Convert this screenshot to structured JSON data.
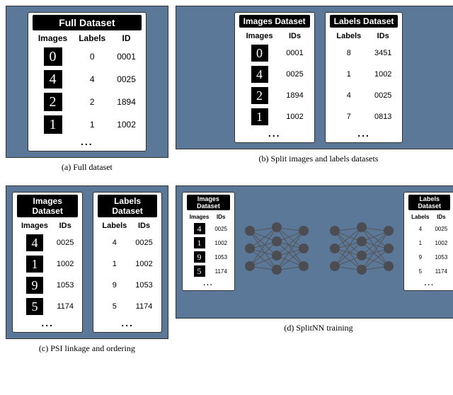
{
  "panels": {
    "a": {
      "caption": "(a) Full dataset",
      "tables": [
        {
          "title": "Full Dataset",
          "columns": [
            "Images",
            "Labels",
            "ID"
          ],
          "rows": [
            {
              "digit": "0",
              "label": "0",
              "id": "0001"
            },
            {
              "digit": "4",
              "label": "4",
              "id": "0025"
            },
            {
              "digit": "2",
              "label": "2",
              "id": "1894"
            },
            {
              "digit": "1",
              "label": "1",
              "id": "1002"
            }
          ],
          "ellipsis": "..."
        }
      ]
    },
    "b": {
      "caption": "(b) Split images and labels datasets",
      "tables": [
        {
          "title": "Images Dataset",
          "columns": [
            "Images",
            "IDs"
          ],
          "rows": [
            {
              "digit": "0",
              "id": "0001"
            },
            {
              "digit": "4",
              "id": "0025"
            },
            {
              "digit": "2",
              "id": "1894"
            },
            {
              "digit": "1",
              "id": "1002"
            }
          ],
          "ellipsis": "..."
        },
        {
          "title": "Labels Dataset",
          "columns": [
            "Labels",
            "IDs"
          ],
          "rows": [
            {
              "label": "8",
              "id": "3451"
            },
            {
              "label": "1",
              "id": "1002"
            },
            {
              "label": "4",
              "id": "0025"
            },
            {
              "label": "7",
              "id": "0813"
            }
          ],
          "ellipsis": "..."
        }
      ]
    },
    "c": {
      "caption": "(c) PSI linkage and ordering",
      "tables": [
        {
          "title": "Images Dataset",
          "columns": [
            "Images",
            "IDs"
          ],
          "rows": [
            {
              "digit": "4",
              "id": "0025"
            },
            {
              "digit": "1",
              "id": "1002"
            },
            {
              "digit": "9",
              "id": "1053"
            },
            {
              "digit": "5",
              "id": "1174"
            }
          ],
          "ellipsis": "..."
        },
        {
          "title": "Labels Dataset",
          "columns": [
            "Labels",
            "IDs"
          ],
          "rows": [
            {
              "label": "4",
              "id": "0025"
            },
            {
              "label": "1",
              "id": "1002"
            },
            {
              "label": "9",
              "id": "1053"
            },
            {
              "label": "5",
              "id": "1174"
            }
          ],
          "ellipsis": "..."
        }
      ]
    },
    "d": {
      "caption": "(d) SplitNN training",
      "tables": [
        {
          "title": "Images Dataset",
          "columns": [
            "Images",
            "IDs"
          ],
          "rows": [
            {
              "digit": "4",
              "id": "0025"
            },
            {
              "digit": "1",
              "id": "1002"
            },
            {
              "digit": "9",
              "id": "1053"
            },
            {
              "digit": "5",
              "id": "1174"
            }
          ],
          "ellipsis": "..."
        },
        {
          "title": "Labels Dataset",
          "columns": [
            "Labels",
            "IDs"
          ],
          "rows": [
            {
              "label": "4",
              "id": "0025"
            },
            {
              "label": "1",
              "id": "1002"
            },
            {
              "label": "9",
              "id": "1053"
            },
            {
              "label": "5",
              "id": "1174"
            }
          ],
          "ellipsis": "..."
        }
      ]
    }
  }
}
